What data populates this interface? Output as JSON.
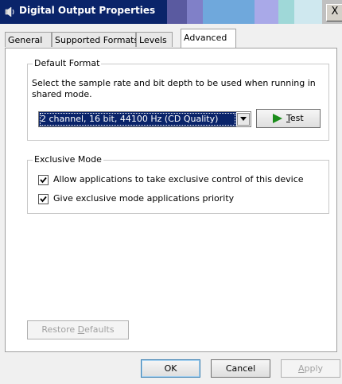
{
  "window": {
    "title": "Digital Output Properties",
    "close_glyph": "X"
  },
  "tabs": [
    {
      "label": "General"
    },
    {
      "label": "Supported Formats"
    },
    {
      "label": "Levels"
    },
    {
      "label": "Advanced"
    }
  ],
  "default_format": {
    "group_title": "Default Format",
    "description": "Select the sample rate and bit depth to be used when running in shared mode.",
    "selected_format": "2 channel, 16 bit, 44100 Hz (CD Quality)",
    "test_button": {
      "accel": "T",
      "rest": "est",
      "icon": "play-icon",
      "icon_color": "#1a8c1a"
    }
  },
  "exclusive_mode": {
    "group_title": "Exclusive Mode",
    "options": [
      {
        "label": "Allow applications to take exclusive control of this device",
        "checked": true
      },
      {
        "label": "Give exclusive mode applications priority",
        "checked": true
      }
    ]
  },
  "restore_defaults": {
    "prefix": "Restore ",
    "accel": "D",
    "rest": "efaults"
  },
  "footer": {
    "ok": "OK",
    "cancel": "Cancel",
    "apply_accel": "A",
    "apply_rest": "pply"
  },
  "colors": {
    "selection": "#0a246a",
    "disabled_text": "#a0a0a0"
  }
}
